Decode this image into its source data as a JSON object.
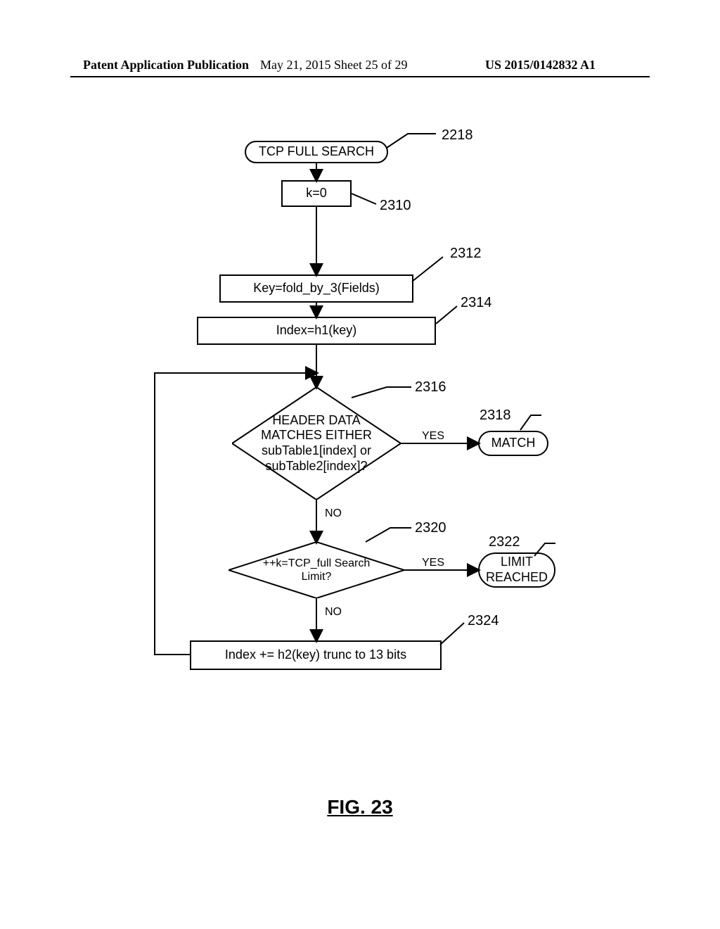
{
  "header": {
    "left": "Patent Application Publication",
    "mid": "May 21, 2015  Sheet 25 of 29",
    "right": "US 2015/0142832 A1"
  },
  "figure_caption": "FIG. 23",
  "nodes": {
    "start": {
      "text": "TCP FULL SEARCH",
      "ref": "2218"
    },
    "n2310": {
      "text": "k=0",
      "ref": "2310"
    },
    "n2312": {
      "text": "Key=fold_by_3(Fields)",
      "ref": "2312"
    },
    "n2314": {
      "text": "Index=h1(key)",
      "ref": "2314"
    },
    "d2316": {
      "text": "HEADER DATA MATCHES EITHER subTable1[index] or subTable2[index]?",
      "ref": "2316"
    },
    "t2318": {
      "text": "MATCH",
      "ref": "2318"
    },
    "d2320": {
      "text": "++k=TCP_full Search Limit?",
      "ref": "2320"
    },
    "t2322": {
      "text": "LIMIT REACHED",
      "ref": "2322"
    },
    "n2324": {
      "text": "Index += h2(key) trunc to 13 bits",
      "ref": "2324"
    }
  },
  "edges": {
    "d2316_yes": "YES",
    "d2316_no": "NO",
    "d2320_yes": "YES",
    "d2320_no": "NO"
  }
}
